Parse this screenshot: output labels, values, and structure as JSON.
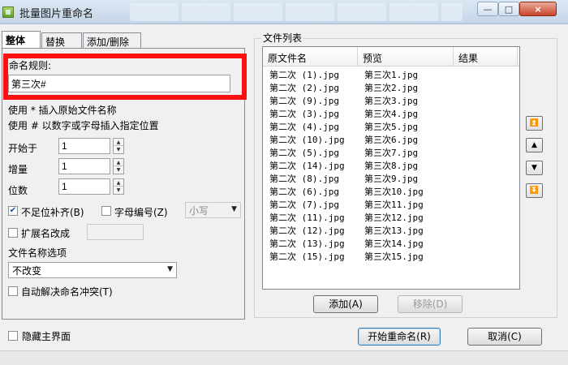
{
  "window": {
    "title": "批量图片重命名",
    "minimize": "—",
    "maximize": "□",
    "close": "×"
  },
  "tabs": [
    {
      "label": "整体"
    },
    {
      "label": "替换"
    },
    {
      "label": "添加/删除"
    }
  ],
  "rule": {
    "label": "命名规则:",
    "value": "第三次#"
  },
  "hints": {
    "line1": "使用 * 插入原始文件名称",
    "line2": "使用 # 以数字或字母插入指定位置"
  },
  "fields": {
    "start_label": "开始于",
    "start_value": "1",
    "step_label": "增量",
    "step_value": "1",
    "digits_label": "位数",
    "digits_value": "1"
  },
  "options": {
    "pad_label": "不足位补齐(B)",
    "pad_checked": true,
    "letter_label": "字母编号(Z)",
    "letter_checked": false,
    "case_value": "小写",
    "ext_label": "扩展名改成",
    "ext_checked": false,
    "ext_value": "",
    "filename_options_label": "文件名称选项",
    "filename_option_value": "不改变",
    "auto_resolve_label": "自动解决命名冲突(T)",
    "auto_resolve_checked": false
  },
  "file_list": {
    "title": "文件列表",
    "columns": [
      "原文件名",
      "预览",
      "结果"
    ],
    "rows": [
      {
        "original": "第二次 (1).jpg",
        "preview": "第三次1.jpg"
      },
      {
        "original": "第二次 (2).jpg",
        "preview": "第三次2.jpg"
      },
      {
        "original": "第二次 (9).jpg",
        "preview": "第三次3.jpg"
      },
      {
        "original": "第二次 (3).jpg",
        "preview": "第三次4.jpg"
      },
      {
        "original": "第二次 (4).jpg",
        "preview": "第三次5.jpg"
      },
      {
        "original": "第二次 (10).jpg",
        "preview": "第三次6.jpg"
      },
      {
        "original": "第二次 (5).jpg",
        "preview": "第三次7.jpg"
      },
      {
        "original": "第二次 (14).jpg",
        "preview": "第三次8.jpg"
      },
      {
        "original": "第二次 (8).jpg",
        "preview": "第三次9.jpg"
      },
      {
        "original": "第二次 (6).jpg",
        "preview": "第三次10.jpg"
      },
      {
        "original": "第二次 (7).jpg",
        "preview": "第三次11.jpg"
      },
      {
        "original": "第二次 (11).jpg",
        "preview": "第三次12.jpg"
      },
      {
        "original": "第二次 (12).jpg",
        "preview": "第三次13.jpg"
      },
      {
        "original": "第二次 (13).jpg",
        "preview": "第三次14.jpg"
      },
      {
        "original": "第二次 (15).jpg",
        "preview": "第三次15.jpg"
      }
    ],
    "add_label": "添加(A)",
    "remove_label": "移除(D)"
  },
  "footer": {
    "hide_main_label": "隐藏主界面",
    "hide_main_checked": false,
    "start_label": "开始重命名(R)",
    "cancel_label": "取消(C)"
  },
  "icons": {
    "move_top": "move-top-icon",
    "move_up": "move-up-icon",
    "move_down": "move-down-icon",
    "move_bottom": "move-bottom-icon"
  }
}
